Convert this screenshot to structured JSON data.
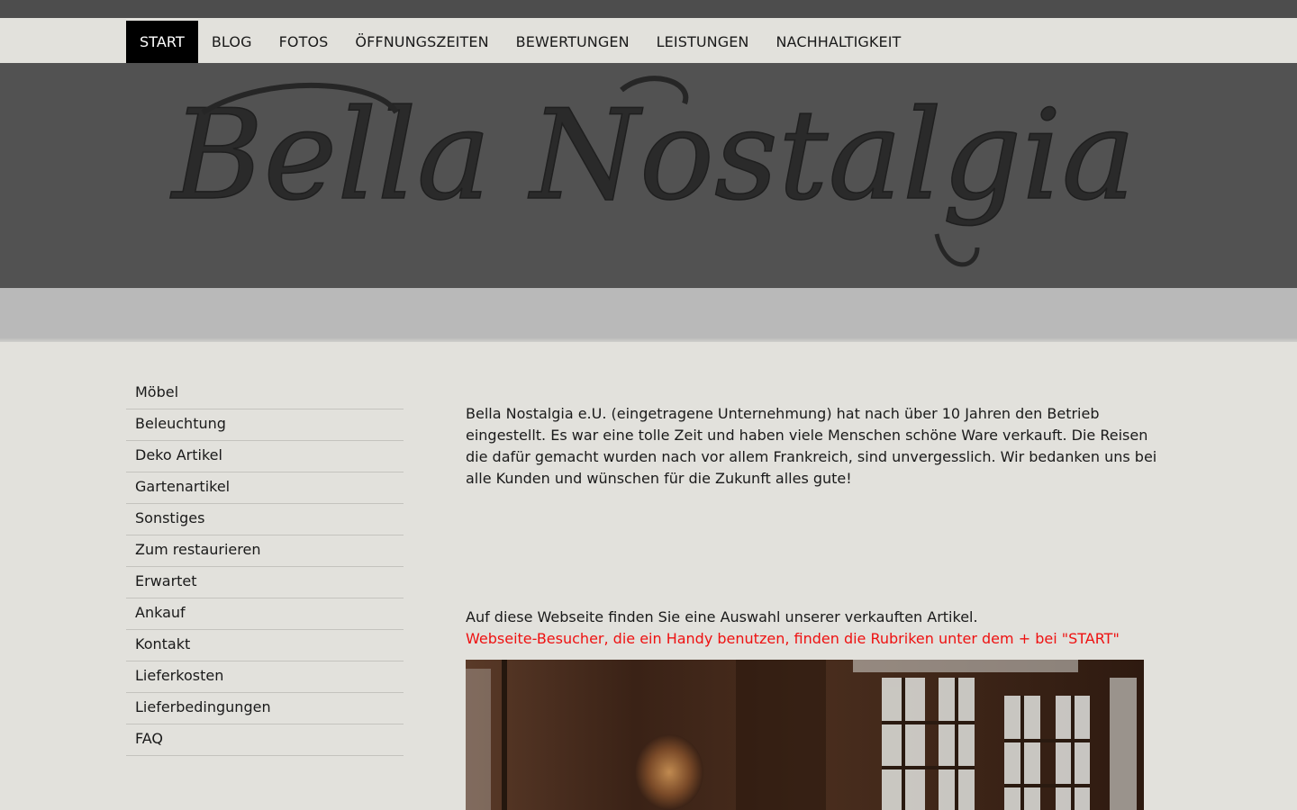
{
  "nav": {
    "items": [
      {
        "label": "START",
        "active": true
      },
      {
        "label": "BLOG"
      },
      {
        "label": "FOTOS"
      },
      {
        "label": "ÖFFNUNGSZEITEN"
      },
      {
        "label": "BEWERTUNGEN"
      },
      {
        "label": "LEISTUNGEN"
      },
      {
        "label": "NACHHALTIGKEIT"
      }
    ]
  },
  "banner": {
    "logo_text": "Bella Nostalgia"
  },
  "sidebar": {
    "items": [
      {
        "label": "Möbel"
      },
      {
        "label": "Beleuchtung"
      },
      {
        "label": "Deko Artikel"
      },
      {
        "label": "Gartenartikel"
      },
      {
        "label": "Sonstiges"
      },
      {
        "label": "Zum restaurieren"
      },
      {
        "label": "Erwartet"
      },
      {
        "label": "Ankauf"
      },
      {
        "label": "Kontakt"
      },
      {
        "label": "Lieferkosten"
      },
      {
        "label": "Lieferbedingungen"
      },
      {
        "label": "FAQ"
      }
    ]
  },
  "main": {
    "intro": "Bella Nostalgia e.U. (eingetragene Unternehmung) hat nach über 10 Jahren den Betrieb eingestellt. Es war eine tolle Zeit und haben viele Menschen schöne Ware verkauft. Die Reisen die dafür gemacht wurden nach vor allem Frankreich, sind unvergesslich. Wir bedanken uns bei alle Kunden und wünschen für die Zukunft alles gute!",
    "selection_note": "Auf diese Webseite finden Sie eine Auswahl unserer verkauften Artikel.",
    "mobile_note": "Webseite-Besucher, die ein Handy benutzen, finden die Rubriken unter dem + bei \"START\""
  },
  "colors": {
    "page_bg": "#e2e1dc",
    "topbar": "#4d4d4d",
    "banner": "#525252",
    "nav_active_bg": "#000000",
    "notice_red": "#ee1111"
  },
  "icons": {
    "photo": "antique-interior-photo"
  }
}
